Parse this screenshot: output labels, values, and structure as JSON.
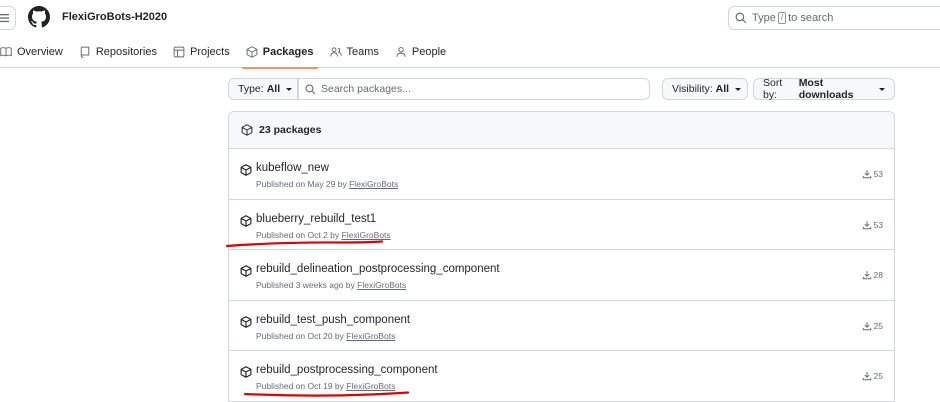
{
  "header": {
    "org_name": "FlexiGroBots-H2020",
    "search_prefix": "Type",
    "search_key": "/",
    "search_suffix": "to search"
  },
  "tabs": [
    {
      "label": "Overview",
      "icon": "book-icon"
    },
    {
      "label": "Repositories",
      "icon": "repo-icon"
    },
    {
      "label": "Projects",
      "icon": "table-icon"
    },
    {
      "label": "Packages",
      "icon": "package-icon",
      "active": true
    },
    {
      "label": "Teams",
      "icon": "people-icon"
    },
    {
      "label": "People",
      "icon": "person-icon"
    }
  ],
  "filters": {
    "type_label": "Type:",
    "type_value": "All",
    "search_placeholder": "Search packages...",
    "visibility_label": "Visibility:",
    "visibility_value": "All",
    "sort_label": "Sort by:",
    "sort_value": "Most downloads"
  },
  "packages_header": "23 packages",
  "packages": [
    {
      "name": "kubeflow_new",
      "published": "Published on May 29 by",
      "by": "FlexiGroBots",
      "downloads": "53"
    },
    {
      "name": "blueberry_rebuild_test1",
      "published": "Published on Oct 2 by",
      "by": "FlexiGroBots",
      "downloads": "53"
    },
    {
      "name": "rebuild_delineation_postprocessing_component",
      "published": "Published 3 weeks ago by",
      "by": "FlexiGroBots",
      "downloads": "28"
    },
    {
      "name": "rebuild_test_push_component",
      "published": "Published on Oct 20 by",
      "by": "FlexiGroBots",
      "downloads": "25"
    },
    {
      "name": "rebuild_postprocessing_component",
      "published": "Published on Oct 19 by",
      "by": "FlexiGroBots",
      "downloads": "25"
    }
  ],
  "colors": {
    "active_tab_underline": "#fd8c73",
    "annotation_red": "#e00000"
  }
}
